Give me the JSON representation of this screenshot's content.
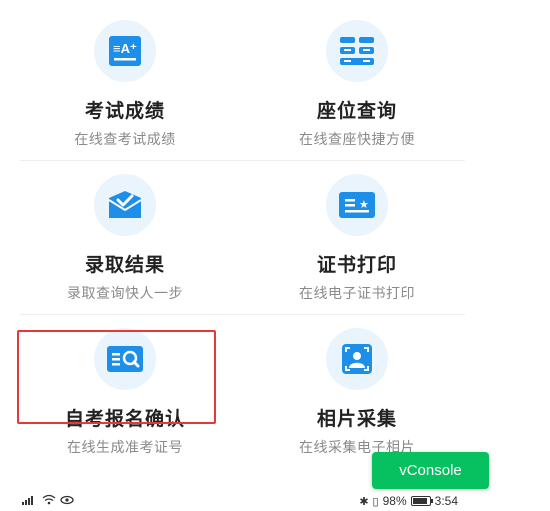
{
  "tiles": [
    {
      "title": "考试成绩",
      "subtitle": "在线查考试成绩",
      "icon": "score-icon"
    },
    {
      "title": "座位查询",
      "subtitle": "在线查座快捷方便",
      "icon": "seat-icon"
    },
    {
      "title": "录取结果",
      "subtitle": "录取查询快人一步",
      "icon": "admission-icon"
    },
    {
      "title": "证书打印",
      "subtitle": "在线电子证书打印",
      "icon": "certificate-icon"
    },
    {
      "title": "自考报名确认",
      "subtitle": "在线生成准考证号",
      "icon": "search-doc-icon"
    },
    {
      "title": "相片采集",
      "subtitle": "在线采集电子相片",
      "icon": "photo-icon"
    }
  ],
  "vconsole": {
    "label": "vConsole"
  },
  "status": {
    "battery": "98%",
    "time": "3:54"
  },
  "colors": {
    "accent": "#1e8fe8",
    "icon_bg": "#eaf4fd",
    "highlight": "#e53935",
    "vconsole": "#07c160"
  }
}
